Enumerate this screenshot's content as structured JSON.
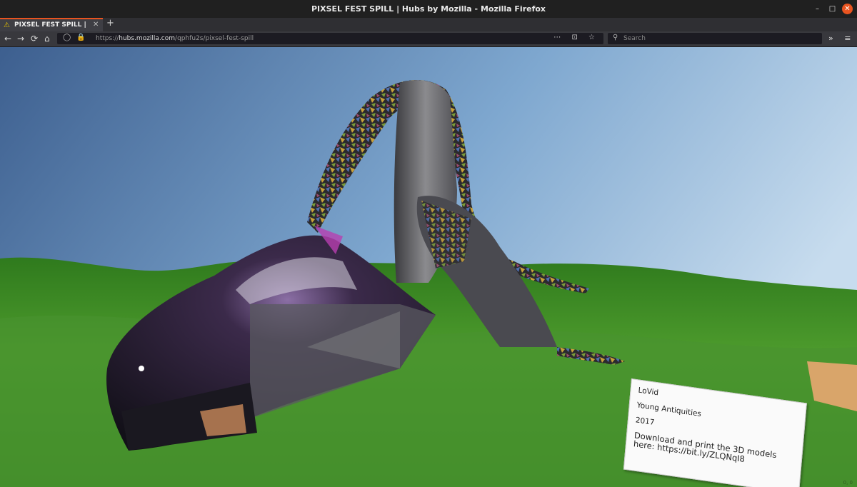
{
  "window": {
    "title": "PIXSEL FEST SPILL | Hubs by Mozilla - Mozilla Firefox",
    "min": "–",
    "max": "□",
    "close": "✕"
  },
  "tabs": {
    "active": {
      "label": "PIXSEL FEST SPILL | Hub",
      "icon": "⚠",
      "close": "✕"
    },
    "new_tab": "+"
  },
  "nav": {
    "back": "←",
    "forward": "→",
    "reload": "⟳",
    "home": "⌂",
    "url_prefix": "https://",
    "url_host": "hubs.mozilla.com",
    "url_path": "/qphfu2s/pixsel-fest-spill",
    "page_actions": "⋯ ⊡ ☆",
    "search_placeholder": "Search",
    "overflow": "» ≡"
  },
  "scene": {
    "placard": {
      "line1": "LoVid",
      "line2": "Young Antiquities",
      "line3": "2017",
      "line4": "Download and print the 3D models here: https://bit.ly/ZLQNqI8"
    },
    "corner_text": "0, 0"
  },
  "colors": {
    "accent": "#e95420",
    "sky_top": "#3d5f8f",
    "sky_bottom": "#b9d3ea",
    "grass": "#3e8a25"
  }
}
